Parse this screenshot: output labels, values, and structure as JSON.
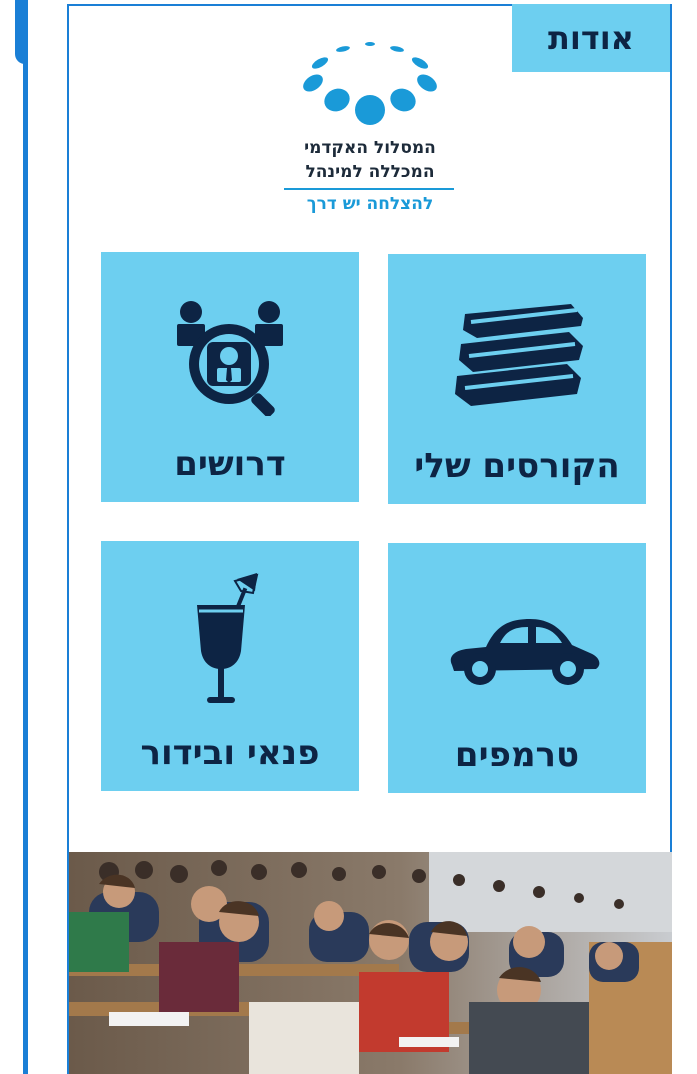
{
  "header": {
    "about_label": "אודות"
  },
  "logo": {
    "line1": "המסלול האקדמי",
    "line2": "המכללה למינהל",
    "tagline": "להצלחה יש דרך"
  },
  "tiles": [
    {
      "label": "הקורסים שלי",
      "icon": "books-icon"
    },
    {
      "label": "דרושים",
      "icon": "job-search-icon"
    },
    {
      "label": "טרמפים",
      "icon": "car-icon"
    },
    {
      "label": "פנאי ובידור",
      "icon": "cocktail-icon"
    }
  ],
  "colors": {
    "tile_bg": "#6dcff0",
    "icon_navy": "#0d2444",
    "accent_blue": "#1a7fd6",
    "logo_blue": "#1a9ad8"
  },
  "banner": {
    "icon": "lecture-hall-photo"
  }
}
